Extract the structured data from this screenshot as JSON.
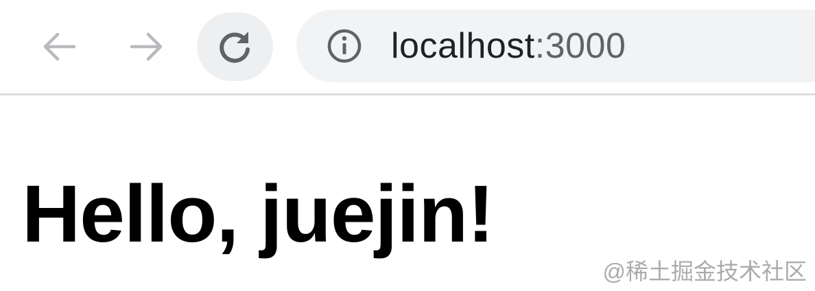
{
  "toolbar": {
    "back_icon": "arrow-left-icon",
    "forward_icon": "arrow-right-icon",
    "reload_icon": "reload-icon",
    "info_icon": "info-icon",
    "address": {
      "host": "localhost",
      "port_part": ":3000"
    }
  },
  "page": {
    "heading": "Hello, juejin!"
  },
  "watermark": {
    "text": "@稀土掘金技术社区"
  },
  "colors": {
    "omnibox_bg": "#f1f3f4",
    "reload_bg": "#eeeff1",
    "icon_disabled": "#b8babd",
    "icon_active": "#5f6368",
    "divider": "#dadce0"
  }
}
